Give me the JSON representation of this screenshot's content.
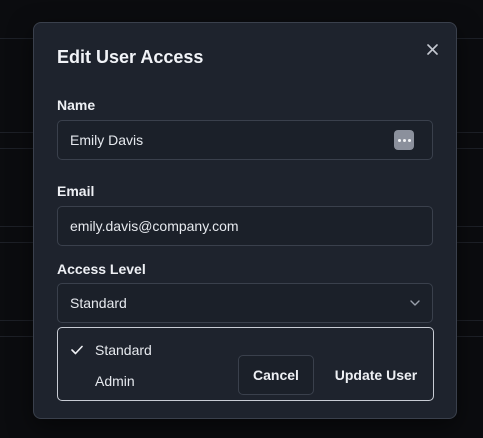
{
  "dialog": {
    "title": "Edit User Access",
    "close_icon": "close-icon"
  },
  "fields": {
    "name": {
      "label": "Name",
      "value": "Emily Davis",
      "icon": "password-manager-icon"
    },
    "email": {
      "label": "Email",
      "value": "emily.davis@company.com"
    },
    "access_level": {
      "label": "Access Level",
      "selected": "Standard",
      "options": [
        {
          "label": "Standard",
          "checked": true
        },
        {
          "label": "Admin",
          "checked": false
        }
      ]
    }
  },
  "actions": {
    "cancel_label": "Cancel",
    "update_label": "Update User"
  },
  "colors": {
    "background": "#0b0c0f",
    "modal": "#1e232d",
    "border": "#3a404c",
    "text": "#eef0f4"
  }
}
